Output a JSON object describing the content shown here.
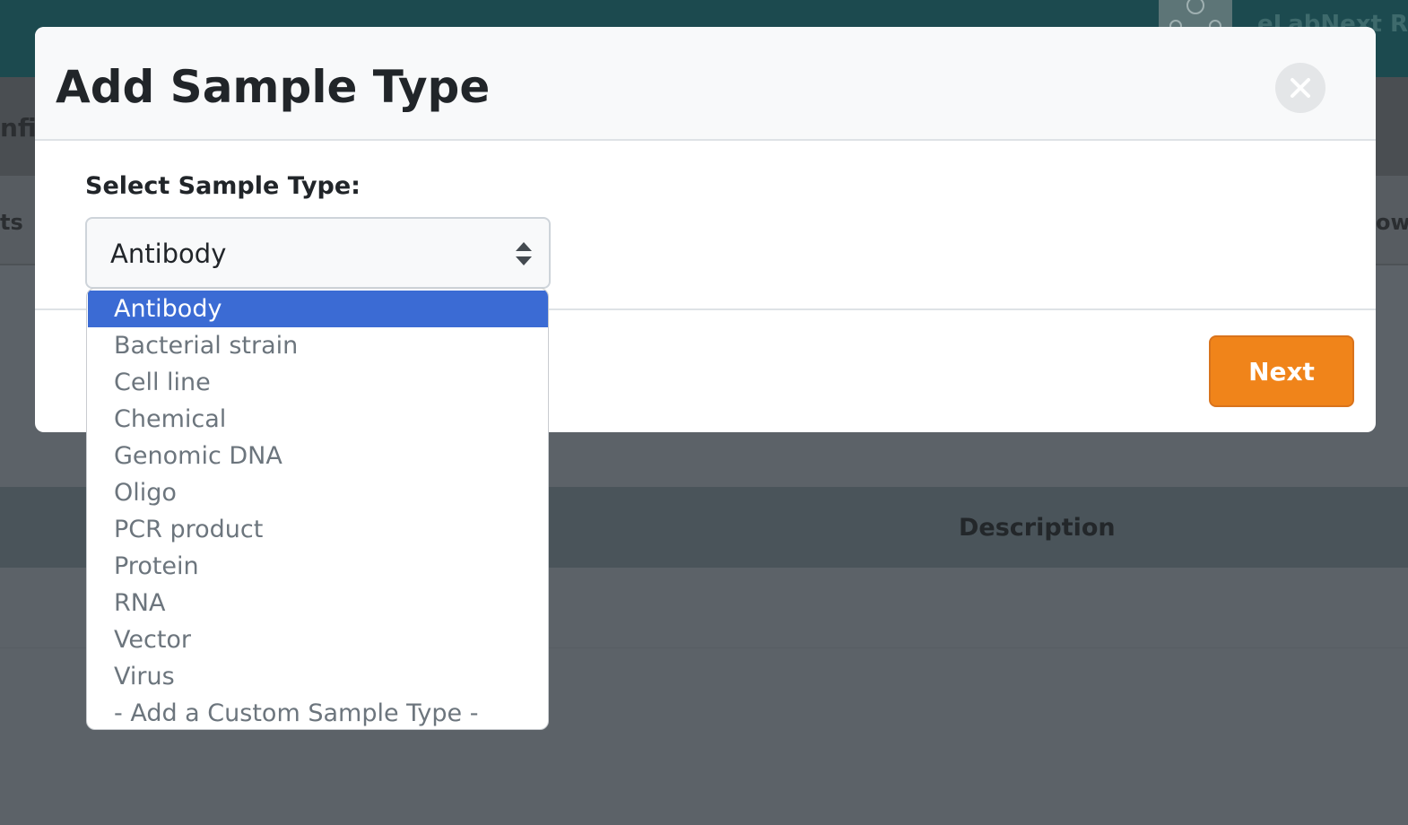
{
  "background": {
    "brand_text": "eLabNext Re",
    "nav_fragment": "nfig",
    "tab_left_fragment": "ts",
    "tab_right_fragment": "ow",
    "table_header_description": "Description"
  },
  "modal": {
    "title": "Add Sample Type",
    "close_icon": "close-icon",
    "field_label": "Select Sample Type:",
    "selected_value": "Antibody",
    "next_label": "Next",
    "options": [
      "Antibody",
      "Bacterial strain",
      "Cell line",
      "Chemical",
      "Genomic DNA",
      "Oligo",
      "PCR product",
      "Protein",
      "RNA",
      "Vector",
      "Virus",
      "- Add a Custom Sample Type -"
    ],
    "selected_index": 0
  },
  "colors": {
    "accent_orange": "#f0841a",
    "selection_blue": "#3b6bd4",
    "topbar_teal": "#1c4a4f"
  }
}
